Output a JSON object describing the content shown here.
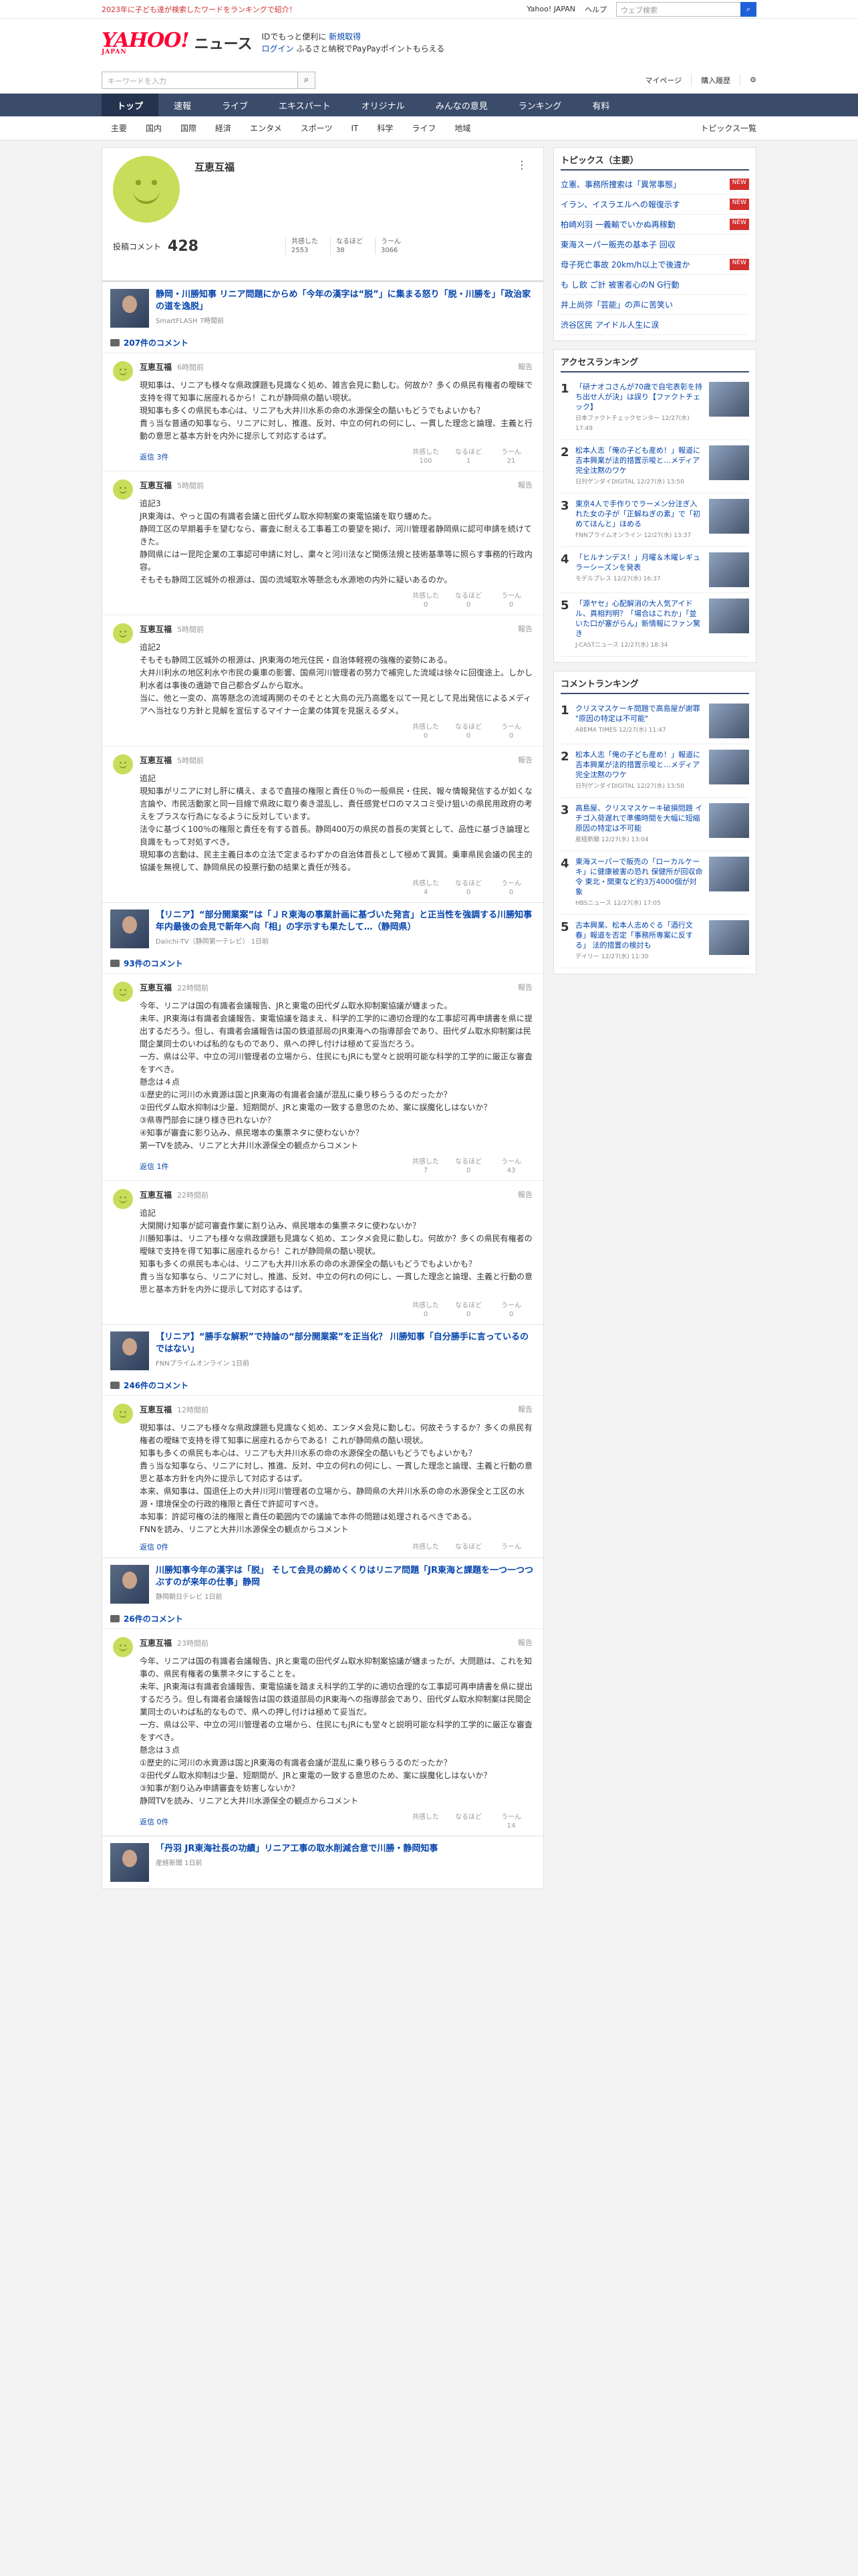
{
  "topbar": {
    "promo": "2023年に子ども達が検索したワードをランキングで紹介！",
    "links": [
      "Yahoo! JAPAN",
      "ヘルプ"
    ],
    "search_placeholder": "ウェブ検索"
  },
  "header": {
    "logo": "YAHOO!",
    "logo_sub": "JAPAN",
    "section": "ニュース",
    "promo1": "IDでもっと便利に",
    "promo1b": "新規取得",
    "promo2": "ログイン",
    "promo3": "ふるさと納税でPayPayポイントもらえる"
  },
  "searchrow": {
    "placeholder": "キーワードを入力",
    "mypage": "マイページ",
    "purchased": "購入履歴"
  },
  "mainnav": [
    "トップ",
    "速報",
    "ライブ",
    "エキスパート",
    "オリジナル",
    "みんなの意見",
    "ランキング",
    "有料"
  ],
  "catnav": [
    "主要",
    "国内",
    "国際",
    "経済",
    "エンタメ",
    "スポーツ",
    "IT",
    "科学",
    "ライフ",
    "地域"
  ],
  "catnav_right": "トピックス一覧",
  "profile": {
    "name": "互恵互福",
    "posts_label": "投稿コメント",
    "posts": "428",
    "empathy_label": "共感した",
    "empathy": "2553",
    "insight_label": "なるほど",
    "insight": "38",
    "hmm_label": "うーん",
    "hmm": "3066"
  },
  "articles": [
    {
      "title": "静岡・川勝知事 リニア問題にからめ「今年の漢字は“脱”」に集まる怒り「脱・川勝を」「政治家の道を逸脱」",
      "source": "SmartFLASH 7時間前",
      "count": "207件のコメント",
      "comments": [
        {
          "time": "6時間前",
          "text": "現知事は、リニアも様々な県政課題も見識なく処め、雑言会見に勤しむ。何故か？多くの県民有権者の曖昧で支持を得て知事に居座れるから！これが静岡県の酷い現状。\n現知事も多くの県民も本心は、リニアも大井川水系の命の水源保全の酷いもどうでもよいかも？\n貴ぅ当な普通の知事なら、リニアに対し、推進、反対、中立の何れの何にし、一貫した理念と論理、主義と行動の意思と基本方針を内外に提示して対応するはず。",
          "replies": "返信 3件",
          "r": [
            "100",
            "1",
            "21"
          ]
        },
        {
          "time": "5時間前",
          "text": "追記3\nJR東海は、やっと国の有識者会議と田代ダム取水抑制案の東電協議を取り纏めた。\n静岡工区の早期着手を望むなら、審査に耐える工事着工の要望を掲げ、河川管理者静岡県に認可申請を続けてきた。\n静岡県には一昆陀企業の工事認可申請に対し、粛々と河川法など関係法規と技術基準等に照らす事務的行政内容。\nそもそも静岡工区城外の根源は、国の流域取水等懸念も水源地の内外に疑いあるのか。",
          "replies": "",
          "r": [
            "0",
            "0",
            "0"
          ]
        },
        {
          "time": "5時間前",
          "text": "追記2\nそもそも静岡工区城外の根源は、JR東海の地元住民・自治体軽視の強権的姿勢にある。\n大井川利水の地区利水や市民の乗車の影響、国県河川管理者の努力で補完した流域は徐々に回復途上。しかし利水者は事後の遺跡で自己都合ダムから取水。\n当に、他と一変の、高等懸念の流域再開のそのそとと大鳥の元乃高鑑を以て一見として見出発信によるメディアへ当社なり方針と見解を宣伝するマイナー企業の体質を見据えるダメ。",
          "replies": "",
          "r": [
            "0",
            "0",
            "0"
          ]
        },
        {
          "time": "5時間前",
          "text": "追記\n現知事がリニアに対し肝に構え、まるで直接の権限と責任０％の一般県民・住民、報々情報発信するが如くな言論や、市民活動家と同一目線で県政に取り奏き混乱し、責任感覚ゼロのマスコミ受け狙いの県民用政府の考えをプラスな行為になるように反対しています。\n法令に基づく100％の権限と責任を有する首長。静岡400万の県民の首長の実質として、品性に基づき論理と良識をもって対処すべき。\n現知事の言動は、民主主義日本の立法で定まるわずかの自治体首長として極めて異質。乗車県民会議の民主的協議を無視して、静岡県民の投票行動の結果と責任が残る。",
          "replies": "",
          "r": [
            "4",
            "0",
            "0"
          ]
        }
      ]
    },
    {
      "title": "【リニア】“部分開業案”は「ＪＲ東海の事業計画に基づいた発言」と正当性を強調する川勝知事 年内最後の会見で新年へ向「相」の字示すも果たして…（静岡県）",
      "source": "Daiichi-TV（静岡第一テレビ） 1日前",
      "count": "93件のコメント",
      "comments": [
        {
          "time": "22時間前",
          "text": "今年、リニアは国の有識者会議報告、JRと東電の田代ダム取水抑制案協議が纏まった。\n未年、JR東海は有識者会議報告、東電協議を踏まえ、科学的工学的に適切合理的な工事認可再申請書を県に提出するだろう。但し、有識者会議報告は国の鉄道部局のJR東海への指導部会であり、田代ダム取水抑制案は民間企業同士のいわば私的なものであり、県への押し付けは極めて妥当だろう。\n一方、県は公平、中立の河川管理者の立場から、住民にもJRにも堂々と説明可能な科学的工学的に厳正な審査をすべき。\n懸念は４点\n①歴史的に河川の水資源は国とJR東海の有識者会議が混乱に乗り移らうるのだったか？\n②田代ダム取水抑制は少量、短期間が、JRと東電の一致する意思のため、案に誤魔化しはないか？\n③県専門部会に謎り様き巴れないか？\n④知事が審査に影り込み、県民増本の集票ネタに使わないか？\n第一TVを読み、リニアと大井川水源保全の観点からコメント",
          "replies": "返信 1件",
          "r": [
            "7",
            "0",
            "43"
          ]
        },
        {
          "time": "22時間前",
          "text": "追記\n大関開け知事が認可審査作業に割り込み、県民増本の集票ネタに使わないか？\n川勝知事は、リニアも様々な県政課題も見識なく処め、エンタメ会見に勤しむ。何故か？多くの県民有権者の曖昧で支持を得て知事に居座れるから！これが静岡県の酷い現状。\n知事も多くの県民も本心は、リニアも大井川水系の命の水源保全の酷いもどうでもよいかも？\n貴ぅ当な知事なら、リニアに対し、推進、反対、中立の何れの何にし、一貫した理念と論理、主義と行動の意思と基本方針を内外に提示して対応するはず。",
          "replies": "",
          "r": [
            "0",
            "0",
            "0"
          ]
        }
      ]
    },
    {
      "title": "【リニア】“勝手な解釈”で持論の“部分開業案”を正当化？ 川勝知事「自分勝手に言っているのではない」",
      "source": "FNNプライムオンライン 1日前",
      "count": "246件のコメント",
      "comments": [
        {
          "time": "12時間前",
          "text": "現知事は、リニアも様々な県政課題も見識なく処め、エンタメ会見に勤しむ。何故そうするか？多くの県民有権者の曖昧で支持を得て知事に居座れるからである！これが静岡県の酷い現状。\n知事も多くの県民も本心は、リニアも大井川水系の命の水源保全の酷いもどうでもよいかも？\n貴ぅ当な知事なら、リニアに対し、推進、反対、中立の何れの何にし、一貫した理念と論理、主義と行動の意思と基本方針を内外に提示して対応するはず。\n本来、県知事は、国退任上の大井川河川管理者の立場から、静岡県の大井川水系の命の水源保全と工区の水源・環境保全の行政的権限と責任で許認可すべき。\n本知事：許認可権の法的権限と責任の範囲内での議論で本件の問題は処理されるべきである。\nFNNを読み、リニアと大井川水源保全の観点からコメント",
          "replies": "返信 0件",
          "r": [
            "",
            "",
            ""
          ]
        }
      ]
    },
    {
      "title": "川勝知事今年の漢字は「脱」 そして会見の締めくくりはリニア問題「JR東海と課題を一つ一つつぶすのが来年の仕事」静岡",
      "source": "静岡朝日テレビ 1日前",
      "count": "26件のコメント",
      "comments": [
        {
          "time": "23時間前",
          "text": "今年、リニアは国の有識者会議報告、JRと東電の田代ダム取水抑制案協議が纏まったが、大問題は、これを知事の、県民有権者の集票ネタにすることを。\n未年、JR東海は有識者会議報告、東電協議を踏まえ科学的工学的に適切合理的な工事認可再申請書を県に提出するだろう。但し有識者会議報告は国の鉄道部局のJR東海への指導部会であり、田代ダム取水抑制案は民間企業同士のいわば私的なもので、県への押し付けは極めて妥当だ。\n一方、県は公平、中立の河川管理者の立場から、住民にもJRにも堂々と説明可能な科学的工学的に厳正な審査をすべき。\n懸念は３点\n①歴史的に河川の水資源は国とJR東海の有識者会議が混乱に乗り移らうるのだったか？\n②田代ダム取水抑制は少量、短期間が、JRと東電の一致する意思のため、案に誤魔化しはないか？\n③知事が割り込み申請審査を妨害しないか？\n静岡TVを読み、リニアと大井川水源保全の観点からコメント",
          "replies": "返信 0件",
          "r": [
            "",
            "",
            "14"
          ]
        }
      ]
    },
    {
      "title": "「丹羽 JR東海社長の功績」リニア工事の取水削減合意で川勝・静岡知事",
      "source": "産経新聞 1日前",
      "count": "",
      "comments": []
    }
  ],
  "react_labels": [
    "共感した",
    "なるほど",
    "うーん"
  ],
  "report_label": "報告",
  "sidebar": {
    "topics_title": "トピックス（主要）",
    "topics": [
      {
        "text": "立憲、事務所捜索は「異常事態」",
        "badge": "NEW"
      },
      {
        "text": "イラン、イスラエルへの報復示す",
        "badge": "NEW"
      },
      {
        "text": "柏崎刈羽 一義輸でいかぬ再稼動",
        "badge": "NEW"
      },
      {
        "text": "東海スーパー販売の基本子 回収",
        "badge": ""
      },
      {
        "text": "母子死亡事故 20km/h以上で後違か",
        "badge": "NEW"
      },
      {
        "text": "も し飲 ご計 被害者心のN G行動",
        "badge": ""
      },
      {
        "text": "井上尚弥「芸能」の声に苦笑い",
        "badge": ""
      },
      {
        "text": "渋谷区民 アイドル人生に涙",
        "badge": ""
      }
    ],
    "access_title": "アクセスランキング",
    "access": [
      {
        "n": "1",
        "t": "「研ナオコさんが70歳で自宅表彰を持ち出せ人が決」は誤り【ファクトチェック】",
        "s": "日本ファクトチェックセンター 12/27(水) 17:49"
      },
      {
        "n": "2",
        "t": "松本人志「俺の子ども産め！」報道に吉本興業が法的措置示唆と…メディア完全沈黙のワケ",
        "s": "日刊ゲンダイDIGITAL 12/27(水) 13:50"
      },
      {
        "n": "3",
        "t": "東京4人で手作りでラーメン分注ぎ入れた女の子が「正解ねぎの素」で「初めてほんと」ほめる",
        "s": "FNNプライムオンライン 12/27(水) 13:37"
      },
      {
        "n": "4",
        "t": "「ヒルナンデス！」月曜＆木曜レギュラーシーズンを発表",
        "s": "モデルプレス 12/27(水) 16:37"
      },
      {
        "n": "5",
        "t": "「源ヤセ」心配解消の大人気アイドル、真相判明？「場合はこれか」「並いた口が塞がらん」新情報にファン驚き",
        "s": "J-CASTニュース 12/27(水) 18:34"
      }
    ],
    "comment_title": "コメントランキング",
    "comment_rank": [
      {
        "n": "1",
        "t": "クリスマスケーキ問題で高島屋が謝罪 \"原因の特定は不可能\"",
        "s": "ABEMA TIMES 12/27(水) 11:47"
      },
      {
        "n": "2",
        "t": "松本人志「俺の子ども産め！」報道に吉本興業が法的措置示唆と…メディア完全沈黙のワケ",
        "s": "日刊ゲンダイDIGITAL 12/27(水) 13:50"
      },
      {
        "n": "3",
        "t": "高島屋、クリスマスケーキ破損問題 イチゴ入荷遅れで準備時間を大幅に短縮 原因の特定は不可能",
        "s": "産経新聞 12/27(水) 13:04"
      },
      {
        "n": "4",
        "t": "東海スーパーで販売の「ローカルケーキ」に健康被害の恐れ 保健所が回収命令 東北・関東など約3万4000個が対象",
        "s": "HBSニュース 12/27(水) 17:05"
      },
      {
        "n": "5",
        "t": "古本興業、松本人志めぐる「酒行文春」報道を否定「事務所専案に反する」 法的措置の検討も",
        "s": "デイリー 12/27(水) 11:30"
      }
    ]
  }
}
